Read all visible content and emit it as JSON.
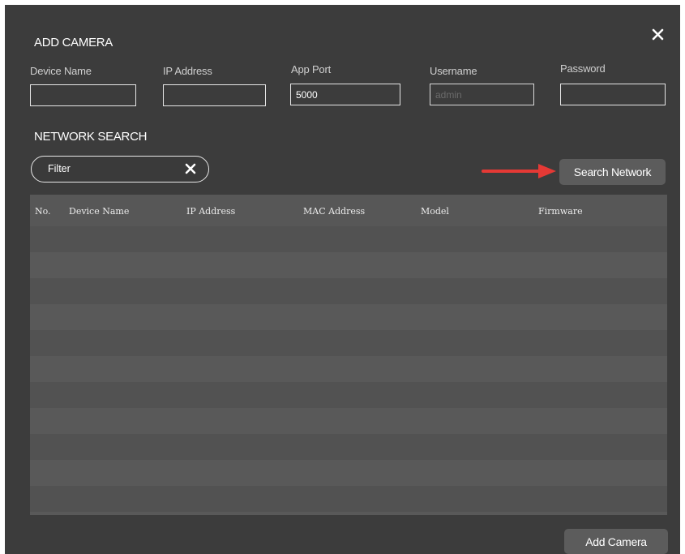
{
  "dialog": {
    "title": "ADD CAMERA",
    "close_icon": "close-icon"
  },
  "fields": {
    "device_name": {
      "label": "Device Name",
      "value": ""
    },
    "ip_address": {
      "label": "IP Address",
      "value": ""
    },
    "app_port": {
      "label": "App Port",
      "value": "5000"
    },
    "username": {
      "label": "Username",
      "placeholder": "admin",
      "value": ""
    },
    "password": {
      "label": "Password",
      "value": ""
    }
  },
  "network_search": {
    "title": "NETWORK SEARCH",
    "filter": {
      "text": "Filter",
      "clear_icon": "clear-icon"
    },
    "search_button": "Search Network",
    "arrow_icon": "red-arrow-icon",
    "arrow_color": "#e53935"
  },
  "table": {
    "columns": [
      "No.",
      "Device Name",
      "IP Address",
      "MAC Address",
      "Model",
      "Firmware"
    ],
    "rows": []
  },
  "footer": {
    "add_button": "Add Camera"
  },
  "colors": {
    "dialog_bg": "#3c3c3c",
    "table_bg": "#575757",
    "button_bg": "#5c5c5c"
  }
}
